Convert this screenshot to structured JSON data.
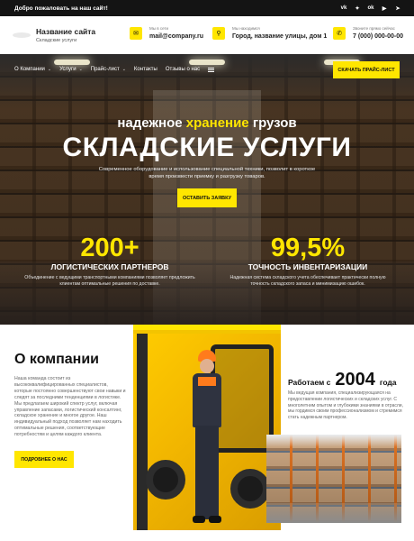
{
  "topbar": {
    "welcome": "Добро пожаловать на наш сайт!",
    "socials": [
      {
        "icon": "vk-icon",
        "glyph": "vk"
      },
      {
        "icon": "twitter-icon",
        "glyph": "✦"
      },
      {
        "icon": "odnoklassniki-icon",
        "glyph": "ok"
      },
      {
        "icon": "youtube-icon",
        "glyph": "▶"
      },
      {
        "icon": "telegram-icon",
        "glyph": "➤"
      }
    ]
  },
  "header": {
    "site_name": "Название сайта",
    "site_sub": "Складские услуги",
    "email_label": "Мы в сети",
    "email": "mail@company.ru",
    "address_label": "Мы находимся",
    "address": "Город, название улицы, дом 1",
    "phone_label": "Звоните прямо сейчас",
    "phone": "7 (000) 000-00-00"
  },
  "nav": {
    "items": [
      "О Компании",
      "Услуги",
      "Прайс-лист",
      "Контакты",
      "Отзывы о нас"
    ],
    "price_button": "СКАЧАТЬ ПРАЙС-ЛИСТ"
  },
  "hero": {
    "sub_before": "надежное ",
    "sub_highlight": "хранение",
    "sub_after": " грузов",
    "title": "СКЛАДСКИЕ УСЛУГИ",
    "description": "Современное оборудование и использование специальной техники, позволит в короткое время произвести приемку и разгрузку товаров.",
    "button": "ОСТАВИТЬ ЗАЯВКУ",
    "stats": [
      {
        "number": "200+",
        "label": "ЛОГИСТИЧЕСКИХ ПАРТНЕРОВ",
        "desc": "Объединение с ведущими транспортными компаниями позволяет предложить клиентам оптимальные решения по доставке."
      },
      {
        "number": "99,5%",
        "label": "ТОЧНОСТЬ ИНВЕНТАРИЗАЦИИ",
        "desc": "Надежная система складского учета обеспечивает практически полную точность складского запаса и минимизацию ошибок."
      }
    ]
  },
  "about": {
    "title": "О компании",
    "text": "Наша команда состоит из высококвалифицированных специалистов, которые постоянно совершенствуют свои навыки и следят за последними тенденциями в логистике. Мы предлагаем широкий спектр услуг, включая управление запасами, логистический консалтинг, складское хранение и многое другое. Наш индивидуальный подход позволяет нам находить оптимальные решения, соответствующие потребностям и целям каждого клиента.",
    "button": "ПОДРОБНЕЕ О НАС",
    "since_before": "Работаем с",
    "since_year": "2004",
    "since_after": "года",
    "since_text": "Мы ведущая компания, специализирующаяся на предоставлении логистических и складских услуг. С многолетним опытом и глубокими знаниями в отрасли, мы гордимся своим профессионализмом и стремимся стать надежным партнером."
  }
}
